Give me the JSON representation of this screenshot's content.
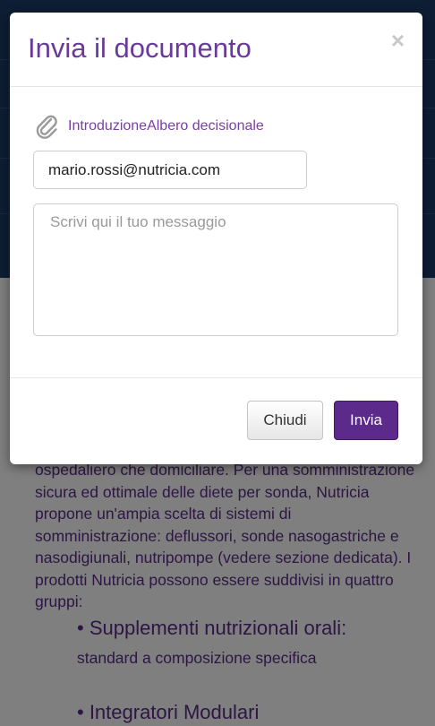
{
  "modal": {
    "title": "Invia il documento",
    "close_glyph": "×",
    "attachment_icon": "paperclip-icon",
    "attachment_name": "IntroduzioneAlbero decisionale",
    "email_value": "mario.rossi@nutricia.com",
    "message_placeholder": "Scrivi qui il tuo messaggio",
    "close_button": "Chiudi",
    "send_button": "Invia"
  },
  "background": {
    "paragraph": "ospedaliero che domiciliare. Per una somministrazione sicura ed ottimale delle diete per sonda, Nutricia propone un'ampia scelta di sistemi di somministrazione: deflussori, sonde nasogastriche e nasodigiunali, nutripompe (vedere sezione dedicata). I prodotti Nutricia possono essere suddivisi in quattro gruppi:",
    "bullet1": "• Supplementi nutrizionali orali:",
    "bullet1_sub": "standard a composizione specifica",
    "bullet2": "• Integratori Modulari"
  },
  "colors": {
    "header_bg": "#1a3a66",
    "title_purple": "#6a3a9a",
    "primary_button": "#5b2a8a",
    "body_text_purple": "#5a2d86"
  }
}
